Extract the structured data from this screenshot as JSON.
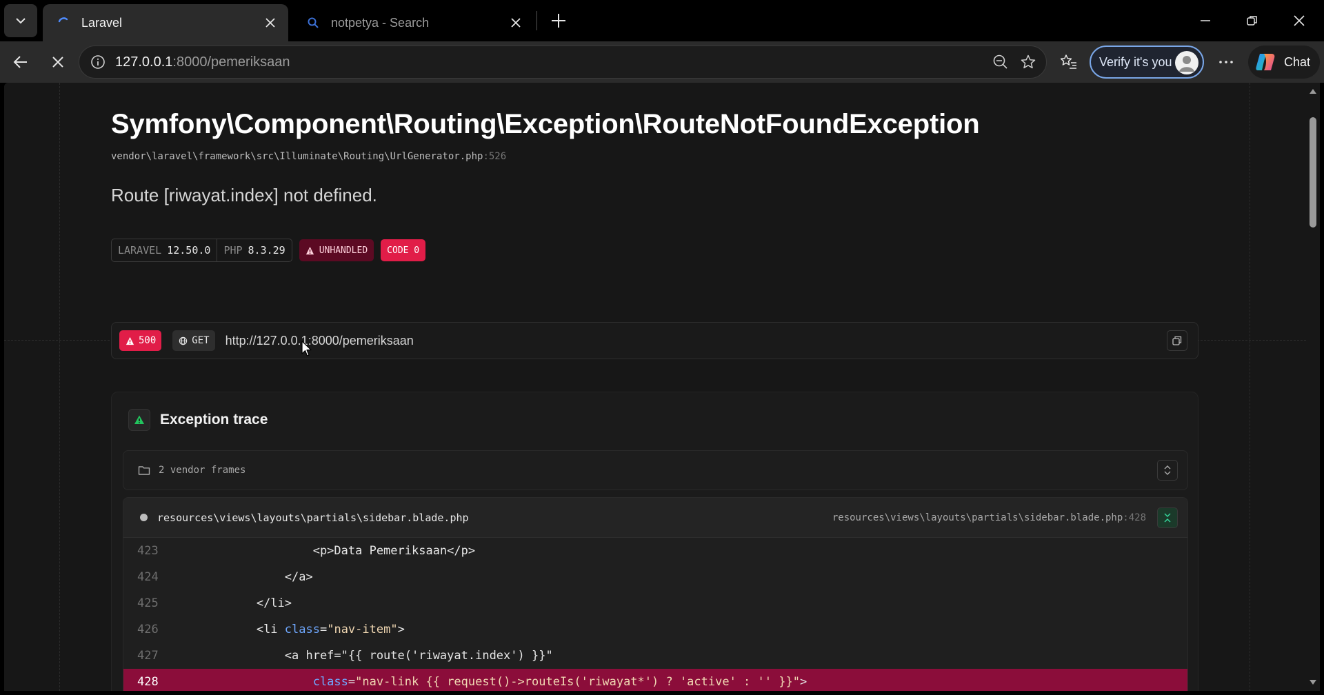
{
  "browser": {
    "tabs": [
      {
        "title": "Laravel",
        "active": true,
        "loading": true
      },
      {
        "title": "notpetya - Search",
        "active": false
      }
    ],
    "address": {
      "host": "127.0.0.1",
      "path": ":8000/pemeriksaan"
    },
    "verify_label": "Verify it's you",
    "chat_label": "Chat",
    "accent": "#7aa7e8"
  },
  "error": {
    "title": "Symfony\\Component\\Routing\\Exception\\RouteNotFoundException",
    "file": "vendor\\laravel\\framework\\src\\Illuminate\\Routing\\UrlGenerator.php",
    "file_line": ":526",
    "message": "Route [riwayat.index] not defined.",
    "versions": [
      {
        "label": "LARAVEL",
        "value": "12.50.0"
      },
      {
        "label": "PHP",
        "value": "8.3.29"
      }
    ],
    "unhandled_label": "UNHANDLED",
    "code_label": "CODE 0",
    "danger_color": "#e11d48"
  },
  "request": {
    "status": "500",
    "method": "GET",
    "url": "http://127.0.0.1:8000/pemeriksaan"
  },
  "trace": {
    "title": "Exception trace",
    "vendor_frames_label": "2 vendor frames",
    "frame": {
      "file": "resources\\views\\layouts\\partials\\sidebar.blade.php",
      "location": "resources\\views\\layouts\\partials\\sidebar.blade.php",
      "location_line": ":428"
    },
    "code_lines": [
      {
        "no": "423",
        "indent": "                    ",
        "text": "<p>Data Pemeriksaan</p>"
      },
      {
        "no": "424",
        "indent": "                ",
        "text": "</a>"
      },
      {
        "no": "425",
        "indent": "            ",
        "text": "</li>"
      },
      {
        "no": "426",
        "indent": "            ",
        "pre": "<li ",
        "attr": "class",
        "eq": "=",
        "str": "\"nav-item\"",
        "post": ">"
      },
      {
        "no": "427",
        "indent": "                ",
        "text": "<a href=\"{{ route('riwayat.index') }}\""
      },
      {
        "no": "428",
        "indent": "                    ",
        "attr": "class",
        "eq": "=",
        "str": "\"nav-link {{ request()->routeIs('riwayat*') ? 'active' : '' }}\"",
        "post": ">",
        "highlight": true
      }
    ]
  }
}
